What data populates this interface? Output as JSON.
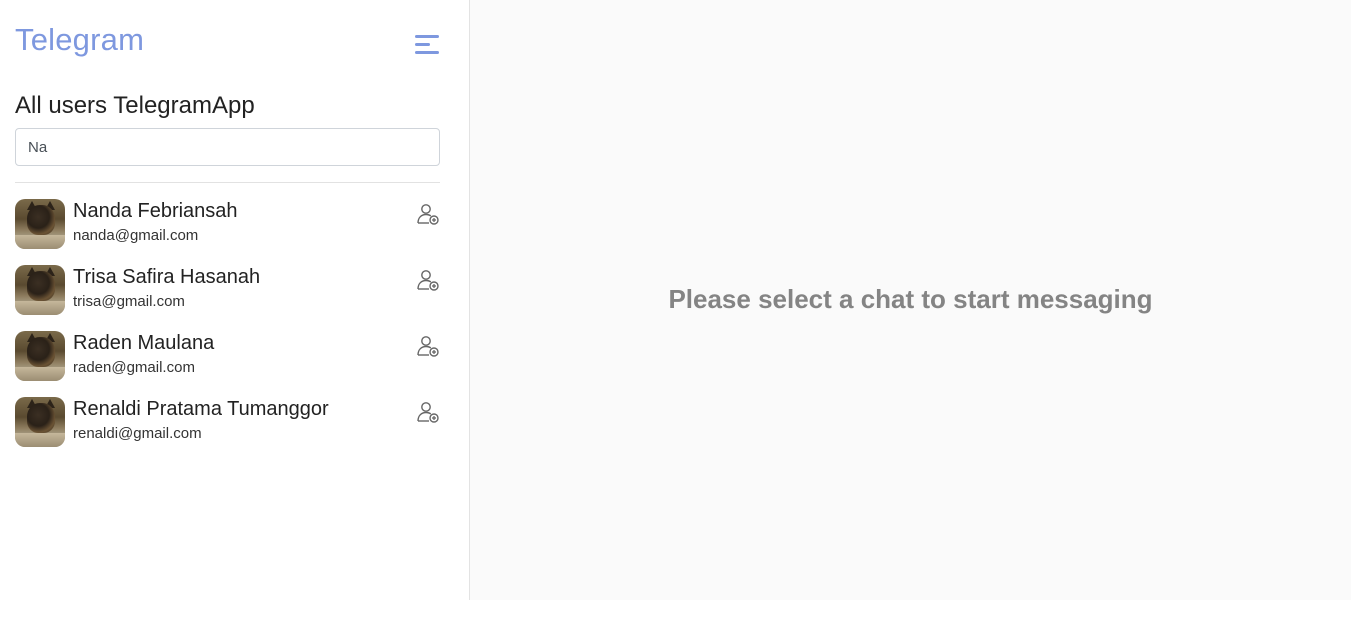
{
  "sidebar": {
    "brand": "Telegram",
    "menu_icon": "hamburger-menu-icon",
    "section_title": "All users TelegramApp",
    "search": {
      "value": "Na",
      "placeholder": ""
    },
    "users": [
      {
        "name": "Nanda Febriansah",
        "email": "nanda@gmail.com",
        "action_icon": "add-contact-icon"
      },
      {
        "name": "Trisa Safira Hasanah",
        "email": "trisa@gmail.com",
        "action_icon": "add-contact-icon"
      },
      {
        "name": "Raden Maulana",
        "email": "raden@gmail.com",
        "action_icon": "add-contact-icon"
      },
      {
        "name": "Renaldi Pratama Tumanggor",
        "email": "renaldi@gmail.com",
        "action_icon": "add-contact-icon"
      }
    ]
  },
  "main": {
    "placeholder": "Please select a chat to start messaging"
  },
  "colors": {
    "brand": "#7e98df",
    "placeholder_text": "#848484",
    "main_background": "#fafafa"
  }
}
